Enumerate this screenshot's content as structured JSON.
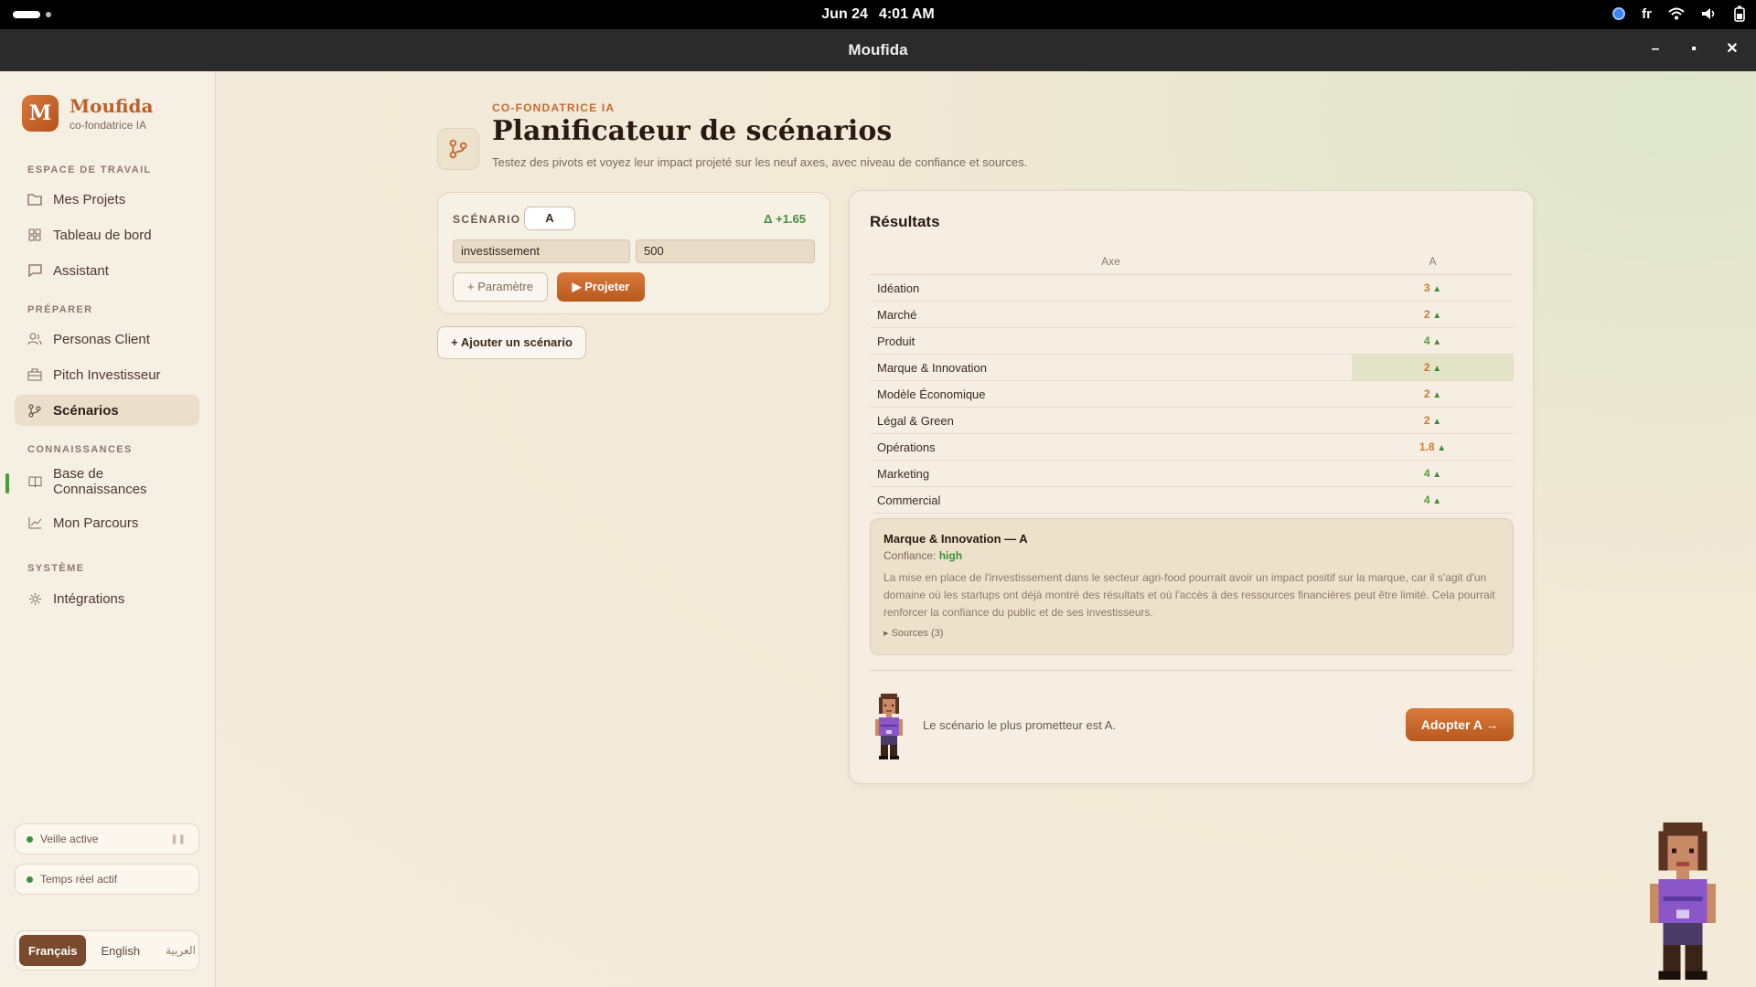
{
  "system": {
    "date": "Jun 24",
    "time": "4:01 AM",
    "lang": "fr"
  },
  "window": {
    "title": "Moufida"
  },
  "sidebar": {
    "brand": {
      "logo_letter": "M",
      "name": "Moufida",
      "subtitle": "co-fondatrice IA"
    },
    "sections": [
      {
        "title": "ESPACE DE TRAVAIL",
        "items": [
          {
            "label": "Mes Projets",
            "icon": "folder-icon"
          },
          {
            "label": "Tableau de bord",
            "icon": "dashboard-icon"
          },
          {
            "label": "Assistant",
            "icon": "chat-icon"
          }
        ]
      },
      {
        "title": "PRÉPARER",
        "items": [
          {
            "label": "Personas Client",
            "icon": "users-icon"
          },
          {
            "label": "Pitch Investisseur",
            "icon": "briefcase-icon"
          },
          {
            "label": "Scénarios",
            "icon": "branch-icon",
            "active": true
          }
        ]
      },
      {
        "title": "CONNAISSANCES",
        "items": [
          {
            "label": "Base de Connaissances",
            "icon": "book-icon"
          },
          {
            "label": "Mon Parcours",
            "icon": "chart-line-icon"
          }
        ]
      },
      {
        "title": "SYSTÈME",
        "items": [
          {
            "label": "Intégrations",
            "icon": "gear-icon"
          }
        ]
      }
    ],
    "status": [
      {
        "label": "Veille active"
      },
      {
        "label": "Temps réel actif"
      }
    ],
    "languages": [
      {
        "label": "Français",
        "active": true
      },
      {
        "label": "English"
      },
      {
        "label": "العربية"
      }
    ]
  },
  "header": {
    "kicker": "CO-FONDATRICE IA",
    "title": "Planificateur de scénarios",
    "subtitle": "Testez des pivots et voyez leur impact projeté sur les neuf axes, avec niveau de confiance et sources."
  },
  "scenario": {
    "label": "SCÉNARIO",
    "name": "A",
    "delta": "Δ +1.65",
    "param_name": "investissement",
    "param_value": "500",
    "add_param_label": "+ Paramètre",
    "project_label": "▶ Projeter",
    "add_scenario_label": "+ Ajouter un scénario"
  },
  "results": {
    "title": "Résultats",
    "columns": [
      "Axe",
      "A"
    ],
    "rows": [
      {
        "axis": "Idéation",
        "value": "3"
      },
      {
        "axis": "Marché",
        "value": "2"
      },
      {
        "axis": "Produit",
        "value": "4"
      },
      {
        "axis": "Marque & Innovation",
        "value": "2",
        "selected": true
      },
      {
        "axis": "Modèle Économique",
        "value": "2"
      },
      {
        "axis": "Légal & Green",
        "value": "2"
      },
      {
        "axis": "Opérations",
        "value": "1.8"
      },
      {
        "axis": "Marketing",
        "value": "4"
      },
      {
        "axis": "Commercial",
        "value": "4"
      }
    ],
    "detail": {
      "title": "Marque & Innovation — A",
      "confidence_label": "Confiance:",
      "confidence_value": "high",
      "body": "La mise en place de l'investissement dans le secteur agri-food pourrait avoir un impact positif sur la marque, car il s'agit d'un domaine où les startups ont déjà montré des résultats et où l'accès à des ressources financières peut être limité. Cela pourrait renforcer la confiance du public et de ses investisseurs.",
      "sources": "Sources (3)"
    },
    "recommendation": "Le scénario le plus prometteur est A.",
    "adopt_label": "Adopter A →"
  },
  "colors": {
    "accent": "#c76a31",
    "positive": "#3f8f3a",
    "value_mid": "#cf7a2e",
    "value_high": "#5a9a3a"
  }
}
